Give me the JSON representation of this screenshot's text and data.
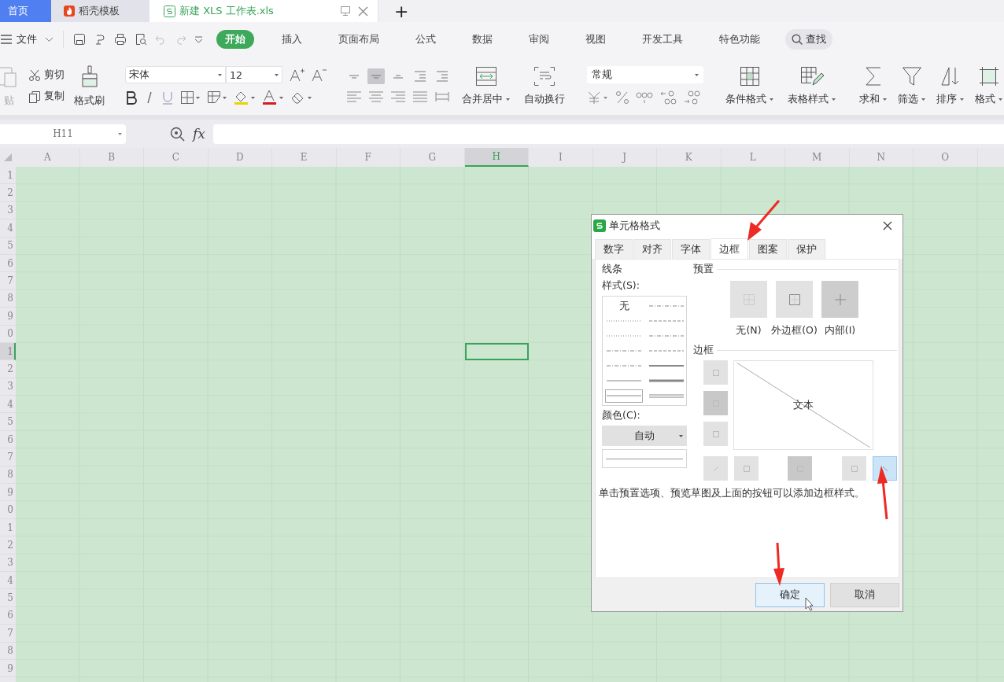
{
  "tabs": [
    {
      "label": "首页",
      "kind": "home",
      "selected": false
    },
    {
      "label": "稻壳模板",
      "kind": "docer",
      "selected": false
    },
    {
      "label": "新建 XLS 工作表.xls",
      "kind": "sheet",
      "selected": true
    }
  ],
  "new_tab": "+",
  "menu": {
    "file": "文件",
    "items": [
      {
        "label": "开始",
        "selected": true
      },
      {
        "label": "插入",
        "selected": false
      },
      {
        "label": "页面布局",
        "selected": false
      },
      {
        "label": "公式",
        "selected": false
      },
      {
        "label": "数据",
        "selected": false
      },
      {
        "label": "审阅",
        "selected": false
      },
      {
        "label": "视图",
        "selected": false
      },
      {
        "label": "开发工具",
        "selected": false
      },
      {
        "label": "特色功能",
        "selected": false
      }
    ],
    "search": "查找"
  },
  "ribbon": {
    "paste": "贴",
    "cut": "剪切",
    "copy": "复制",
    "format_painter": "格式刷",
    "font": "宋体",
    "size": "12",
    "align": [
      {
        "pressed": false
      },
      {
        "pressed": true
      },
      {
        "pressed": false
      },
      {
        "pressed": false
      },
      {
        "pressed": false
      }
    ],
    "merge": "合并居中",
    "wrap": "自动换行",
    "number_format": "常规",
    "cond_format": "条件格式",
    "table_style": "表格样式",
    "sum": "求和",
    "filter": "筛选",
    "sort": "排序",
    "format": "格式"
  },
  "formula_bar": {
    "name_box": "H11",
    "fx": "fx"
  },
  "sheet": {
    "columns": [
      {
        "label": "A",
        "selected": false
      },
      {
        "label": "B",
        "selected": false
      },
      {
        "label": "C",
        "selected": false
      },
      {
        "label": "D",
        "selected": false
      },
      {
        "label": "E",
        "selected": false
      },
      {
        "label": "F",
        "selected": false
      },
      {
        "label": "G",
        "selected": false
      },
      {
        "label": "H",
        "selected": true
      },
      {
        "label": "I",
        "selected": false
      },
      {
        "label": "J",
        "selected": false
      },
      {
        "label": "K",
        "selected": false
      },
      {
        "label": "L",
        "selected": false
      },
      {
        "label": "M",
        "selected": false
      },
      {
        "label": "N",
        "selected": false
      },
      {
        "label": "O",
        "selected": false
      }
    ],
    "rows": [
      {
        "label": "1",
        "selected": false
      },
      {
        "label": "2",
        "selected": false
      },
      {
        "label": "3",
        "selected": false
      },
      {
        "label": "4",
        "selected": false
      },
      {
        "label": "5",
        "selected": false
      },
      {
        "label": "6",
        "selected": false
      },
      {
        "label": "7",
        "selected": false
      },
      {
        "label": "8",
        "selected": false
      },
      {
        "label": "9",
        "selected": false
      },
      {
        "label": "0",
        "selected": false
      },
      {
        "label": "1",
        "selected": true
      },
      {
        "label": "2",
        "selected": false
      },
      {
        "label": "3",
        "selected": false
      },
      {
        "label": "4",
        "selected": false
      },
      {
        "label": "5",
        "selected": false
      },
      {
        "label": "6",
        "selected": false
      },
      {
        "label": "7",
        "selected": false
      },
      {
        "label": "8",
        "selected": false
      },
      {
        "label": "9",
        "selected": false
      },
      {
        "label": "0",
        "selected": false
      },
      {
        "label": "1",
        "selected": false
      },
      {
        "label": "2",
        "selected": false
      },
      {
        "label": "3",
        "selected": false
      },
      {
        "label": "4",
        "selected": false
      },
      {
        "label": "5",
        "selected": false
      },
      {
        "label": "6",
        "selected": false
      },
      {
        "label": "7",
        "selected": false
      },
      {
        "label": "8",
        "selected": false
      },
      {
        "label": "9",
        "selected": false
      }
    ]
  },
  "dialog": {
    "title": "单元格格式",
    "tabs": [
      {
        "label": "数字",
        "selected": false
      },
      {
        "label": "对齐",
        "selected": false
      },
      {
        "label": "字体",
        "selected": false
      },
      {
        "label": "边框",
        "selected": true
      },
      {
        "label": "图案",
        "selected": false
      },
      {
        "label": "保护",
        "selected": false
      }
    ],
    "lines_label": "线条",
    "style_label": "样式(S):",
    "line_styles": [
      {
        "kind": "none",
        "label": "无",
        "selected": false
      },
      {
        "kind": "dashdot",
        "selected": false
      },
      {
        "kind": "dotted",
        "selected": false
      },
      {
        "kind": "dashed",
        "selected": false
      },
      {
        "kind": "dotted",
        "selected": false
      },
      {
        "kind": "dashdot",
        "selected": false
      },
      {
        "kind": "dashdot",
        "selected": false
      },
      {
        "kind": "dashed",
        "selected": false
      },
      {
        "kind": "dashdot",
        "selected": false
      },
      {
        "kind": "medium",
        "selected": false
      },
      {
        "kind": "solid",
        "selected": false
      },
      {
        "kind": "thick",
        "selected": false
      },
      {
        "kind": "solid",
        "selected": true
      },
      {
        "kind": "double",
        "selected": false
      }
    ],
    "color_label": "颜色(C):",
    "color_value": "自动",
    "preset_label": "预置",
    "presets": [
      {
        "label": "无(N)",
        "pressed": false
      },
      {
        "label": "外边框(O)",
        "pressed": false
      },
      {
        "label": "内部(I)",
        "pressed": true
      }
    ],
    "border_label": "边框",
    "preview_text": "文本",
    "side_buttons": [
      {
        "pressed": false
      },
      {
        "pressed": true
      },
      {
        "pressed": false
      }
    ],
    "bottom_buttons": [
      {
        "pressed": false,
        "selected": false
      },
      {
        "pressed": false,
        "selected": false
      },
      {
        "pressed": true,
        "selected": false
      },
      {
        "pressed": false,
        "selected": false
      },
      {
        "pressed": false,
        "selected": true
      }
    ],
    "hint": "单击预置选项、预览草图及上面的按钮可以添加边框样式。",
    "buttons": [
      {
        "label": "确定",
        "focused": true
      },
      {
        "label": "取消",
        "focused": false
      }
    ]
  }
}
